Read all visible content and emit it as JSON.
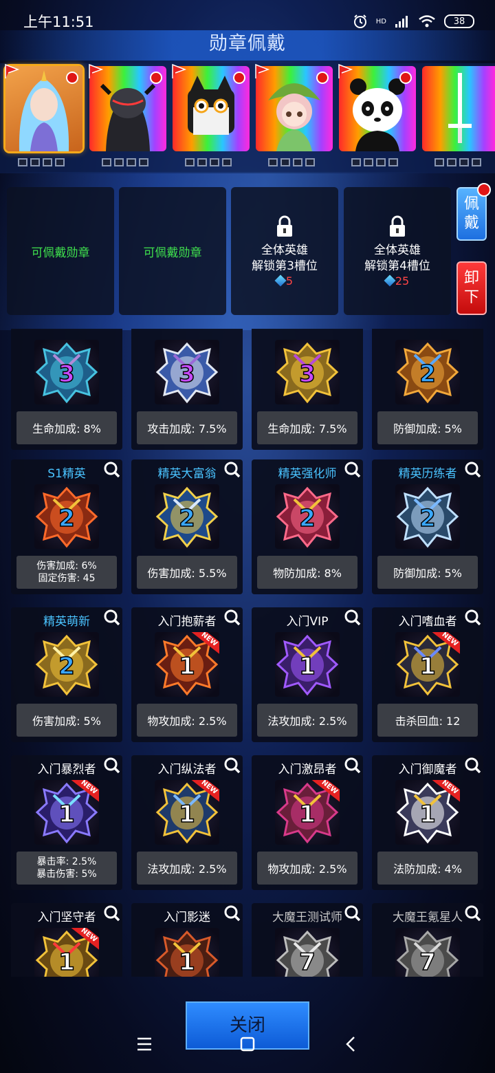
{
  "status_bar": {
    "time": "上午11:51",
    "signal_label": "HD",
    "battery": "38"
  },
  "title": "勋章佩戴",
  "heroes": [
    {
      "name": "blue-haired-girl",
      "selected": true
    },
    {
      "name": "dark-knight",
      "selected": false
    },
    {
      "name": "black-cat",
      "selected": false
    },
    {
      "name": "leaf-fairy",
      "selected": false
    },
    {
      "name": "panda",
      "selected": false
    },
    {
      "name": "white-sword",
      "selected": false
    }
  ],
  "equip_slots": [
    {
      "text": "可佩戴勋章"
    },
    {
      "text": "可佩戴勋章"
    },
    {
      "line1": "全体英雄",
      "line2": "解锁第3槽位",
      "cost": "5"
    },
    {
      "line1": "全体英雄",
      "line2": "解锁第4槽位",
      "cost": "25"
    }
  ],
  "buttons": {
    "wear_1": "佩",
    "wear_2": "戴",
    "remove_1": "卸",
    "remove_2": "下",
    "close": "关闭"
  },
  "medals": [
    {
      "name": "",
      "level": "3",
      "stat1": "生命加成: 8%",
      "stat2": ""
    },
    {
      "name": "",
      "level": "3",
      "stat1": "攻击加成: 7.5%",
      "stat2": ""
    },
    {
      "name": "",
      "level": "3",
      "stat1": "生命加成: 7.5%",
      "stat2": ""
    },
    {
      "name": "",
      "level": "2",
      "stat1": "防御加成: 5%",
      "stat2": ""
    },
    {
      "name": "S1精英",
      "level": "2",
      "stat1": "伤害加成: 6%",
      "stat2": "固定伤害: 45"
    },
    {
      "name": "精英大富翁",
      "level": "2",
      "stat1": "伤害加成: 5.5%",
      "stat2": ""
    },
    {
      "name": "精英强化师",
      "level": "2",
      "stat1": "物防加成: 8%",
      "stat2": ""
    },
    {
      "name": "精英历练者",
      "level": "2",
      "stat1": "防御加成: 5%",
      "stat2": ""
    },
    {
      "name": "精英萌新",
      "level": "2",
      "stat1": "伤害加成: 5%",
      "stat2": ""
    },
    {
      "name": "入门抱薪者",
      "level": "1",
      "new": "NEW",
      "stat1": "物攻加成: 2.5%",
      "stat2": ""
    },
    {
      "name": "入门VIP",
      "level": "1",
      "stat1": "法攻加成: 2.5%",
      "stat2": ""
    },
    {
      "name": "入门嗜血者",
      "level": "1",
      "new": "NEW",
      "stat1": "击杀回血: 12",
      "stat2": ""
    },
    {
      "name": "入门暴烈者",
      "level": "1",
      "new": "NEW",
      "stat1": "暴击率: 2.5%",
      "stat2": "暴击伤害: 5%"
    },
    {
      "name": "入门纵法者",
      "level": "1",
      "new": "NEW",
      "stat1": "法攻加成: 2.5%",
      "stat2": ""
    },
    {
      "name": "入门激昂者",
      "level": "1",
      "new": "NEW",
      "stat1": "物攻加成: 2.5%",
      "stat2": ""
    },
    {
      "name": "入门御魔者",
      "level": "1",
      "new": "NEW",
      "stat1": "法防加成: 4%",
      "stat2": ""
    },
    {
      "name": "入门坚守者",
      "level": "1",
      "new": "NEW",
      "stat1": "",
      "stat2": ""
    },
    {
      "name": "入门影迷",
      "level": "1",
      "stat1": "",
      "stat2": ""
    },
    {
      "name": "大魔王测试师",
      "level": "7",
      "stat1": "",
      "stat2": ""
    },
    {
      "name": "大魔王氪星人",
      "level": "7",
      "stat1": "",
      "stat2": ""
    }
  ],
  "colors": {
    "accent_blue": "#4ac3ff",
    "unlock_green": "#3fe04d",
    "cost_red": "#ff4545",
    "notify_red": "#e01616"
  }
}
